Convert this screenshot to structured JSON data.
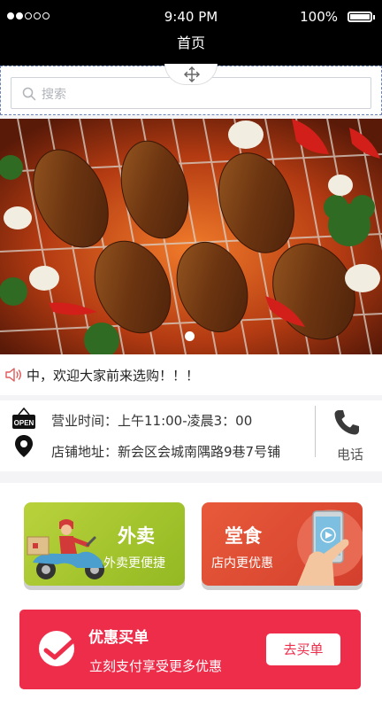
{
  "status_bar": {
    "time": "9:40 PM",
    "battery": "100%"
  },
  "nav": {
    "title": "首页"
  },
  "search": {
    "placeholder": "搜索"
  },
  "notice": {
    "text": "中，欢迎大家前来选购！！！"
  },
  "store_info": {
    "hours": "营业时间：上午11:00-凌晨3：00",
    "address": "店铺地址：新会区会城南隅路9巷7号铺",
    "phone_label": "电话",
    "open_sign": "OPEN"
  },
  "cards": {
    "takeout": {
      "title": "外卖",
      "subtitle": "外卖更便捷"
    },
    "dine_in": {
      "title": "堂食",
      "subtitle": "店内更优惠"
    }
  },
  "promo": {
    "title": "优惠买单",
    "subtitle": "立刻支付享受更多优惠",
    "button": "去买单"
  },
  "colors": {
    "takeout": "#a9c72f",
    "dine_in": "#e0503a",
    "promo": "#ee2d4b"
  }
}
